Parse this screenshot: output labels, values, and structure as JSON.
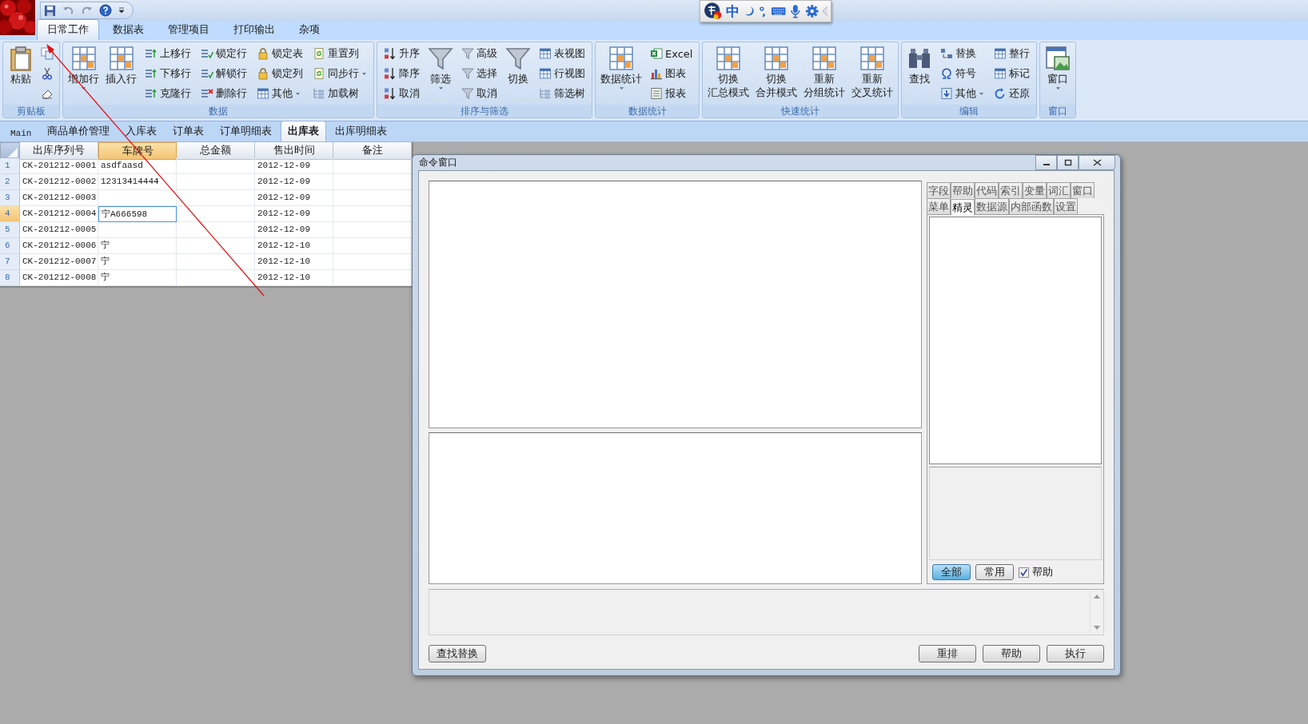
{
  "ribbon": {
    "tabs": [
      {
        "label": "日常工作",
        "selected": true
      },
      {
        "label": "数据表",
        "selected": false
      },
      {
        "label": "管理项目",
        "selected": false
      },
      {
        "label": "打印输出",
        "selected": false
      },
      {
        "label": "杂项",
        "selected": false
      }
    ],
    "groups": [
      {
        "label": "剪贴板",
        "kind": "clipboard",
        "columns": [
          {
            "kind": "large",
            "label": "粘贴",
            "dropdown": false
          }
        ]
      },
      {
        "label": "数据",
        "kind": "plain",
        "columns": [
          {
            "kind": "large",
            "label": "增加行",
            "dropdown": true
          },
          {
            "kind": "large",
            "label": "插入行",
            "dropdown": false
          },
          {
            "kind": "stack",
            "items": [
              {
                "label": "上移行",
                "dropdown": false
              },
              {
                "label": "下移行",
                "dropdown": false
              },
              {
                "label": "克隆行",
                "dropdown": false
              }
            ]
          },
          {
            "kind": "stack",
            "items": [
              {
                "label": "锁定行",
                "dropdown": false
              },
              {
                "label": "解锁行",
                "dropdown": false
              },
              {
                "label": "删除行",
                "dropdown": false
              }
            ]
          },
          {
            "kind": "stack",
            "items": [
              {
                "label": "锁定表",
                "dropdown": false
              },
              {
                "label": "锁定列",
                "dropdown": false
              },
              {
                "label": "其他",
                "dropdown": true
              }
            ]
          },
          {
            "kind": "stack",
            "items": [
              {
                "label": "重置列",
                "dropdown": false
              },
              {
                "label": "同步行",
                "dropdown": true
              },
              {
                "label": "加载树",
                "dropdown": false
              }
            ]
          }
        ]
      },
      {
        "label": "排序与筛选",
        "kind": "plain",
        "columns": [
          {
            "kind": "stack",
            "items": [
              {
                "label": "升序",
                "dropdown": false
              },
              {
                "label": "降序",
                "dropdown": false
              },
              {
                "label": "取消",
                "dropdown": false
              }
            ]
          },
          {
            "kind": "large",
            "label": "筛选",
            "dropdown": true
          },
          {
            "kind": "stack",
            "items": [
              {
                "label": "高级",
                "dropdown": false
              },
              {
                "label": "选择",
                "dropdown": false
              },
              {
                "label": "取消",
                "dropdown": false
              }
            ]
          },
          {
            "kind": "large",
            "label": "切换",
            "dropdown": false
          },
          {
            "kind": "stack",
            "items": [
              {
                "label": "表视图",
                "dropdown": false
              },
              {
                "label": "行视图",
                "dropdown": false
              },
              {
                "label": "筛选树",
                "dropdown": false
              }
            ]
          }
        ]
      },
      {
        "label": "数据统计",
        "kind": "plain",
        "columns": [
          {
            "kind": "large",
            "label": "数据统计",
            "dropdown": true
          },
          {
            "kind": "stack",
            "items": [
              {
                "label": "Excel",
                "dropdown": false
              },
              {
                "label": "图表",
                "dropdown": false
              },
              {
                "label": "报表",
                "dropdown": false
              }
            ]
          }
        ]
      },
      {
        "label": "快速统计",
        "kind": "plain",
        "columns": [
          {
            "kind": "large",
            "lines": [
              "切换",
              "汇总模式"
            ],
            "dropdown": false
          },
          {
            "kind": "large",
            "lines": [
              "切换",
              "合并模式"
            ],
            "dropdown": false
          },
          {
            "kind": "large",
            "lines": [
              "重新",
              "分组统计"
            ],
            "dropdown": false
          },
          {
            "kind": "large",
            "lines": [
              "重新",
              "交叉统计"
            ],
            "dropdown": false
          }
        ]
      },
      {
        "label": "编辑",
        "kind": "plain",
        "columns": [
          {
            "kind": "large",
            "label": "查找",
            "dropdown": false
          },
          {
            "kind": "stack",
            "items": [
              {
                "label": "替换",
                "dropdown": false
              },
              {
                "label": "符号",
                "dropdown": false
              },
              {
                "label": "其他",
                "dropdown": true
              }
            ]
          },
          {
            "kind": "stack",
            "items": [
              {
                "label": "整行",
                "dropdown": false
              },
              {
                "label": "标记",
                "dropdown": false
              },
              {
                "label": "还原",
                "dropdown": false
              }
            ]
          }
        ]
      },
      {
        "label": "窗口",
        "kind": "plain",
        "columns": [
          {
            "kind": "large",
            "label": "窗口",
            "dropdown": true
          }
        ]
      }
    ]
  },
  "ime_toolbar": {
    "mode": "中"
  },
  "doc_tabs": [
    {
      "label": "Main",
      "selected": false
    },
    {
      "label": "商品单价管理",
      "selected": false
    },
    {
      "label": "入库表",
      "selected": false
    },
    {
      "label": "订单表",
      "selected": false
    },
    {
      "label": "订单明细表",
      "selected": false
    },
    {
      "label": "出库表",
      "selected": true
    },
    {
      "label": "出库明细表",
      "selected": false
    }
  ],
  "table": {
    "columns": [
      {
        "label": "出库序列号",
        "selected": false
      },
      {
        "label": "车牌号",
        "selected": true
      },
      {
        "label": "总金额",
        "selected": false
      },
      {
        "label": "售出时间",
        "selected": false
      },
      {
        "label": "备注",
        "selected": false
      }
    ],
    "rows": [
      {
        "number": "1",
        "selected": false,
        "cells": [
          "CK-201212-0001",
          "asdfaasd",
          "",
          "2012-12-09",
          ""
        ]
      },
      {
        "number": "2",
        "selected": false,
        "cells": [
          "CK-201212-0002",
          "12313414444",
          "",
          "2012-12-09",
          ""
        ]
      },
      {
        "number": "3",
        "selected": false,
        "cells": [
          "CK-201212-0003",
          "",
          "",
          "2012-12-09",
          ""
        ]
      },
      {
        "number": "4",
        "selected": true,
        "cells": [
          "CK-201212-0004",
          "宁A666598",
          "",
          "2012-12-09",
          ""
        ]
      },
      {
        "number": "5",
        "selected": false,
        "cells": [
          "CK-201212-0005",
          "",
          "",
          "2012-12-09",
          ""
        ]
      },
      {
        "number": "6",
        "selected": false,
        "cells": [
          "CK-201212-0006",
          "宁",
          "",
          "2012-12-10",
          ""
        ]
      },
      {
        "number": "7",
        "selected": false,
        "cells": [
          "CK-201212-0007",
          "宁",
          "",
          "2012-12-10",
          ""
        ]
      },
      {
        "number": "8",
        "selected": false,
        "cells": [
          "CK-201212-0008",
          "宁",
          "",
          "2012-12-10",
          ""
        ]
      }
    ]
  },
  "command_window": {
    "title": "命令窗口",
    "tabs_row1": [
      {
        "label": "字段",
        "selected": false
      },
      {
        "label": "帮助",
        "selected": false
      },
      {
        "label": "代码",
        "selected": false
      },
      {
        "label": "索引",
        "selected": false
      },
      {
        "label": "变量",
        "selected": false
      },
      {
        "label": "词汇",
        "selected": false
      },
      {
        "label": "窗口",
        "selected": false
      }
    ],
    "tabs_row2": [
      {
        "label": "菜单",
        "selected": false
      },
      {
        "label": "精灵",
        "selected": true
      },
      {
        "label": "数据源",
        "selected": false
      },
      {
        "label": "内部函数",
        "selected": false
      },
      {
        "label": "设置",
        "selected": false
      }
    ],
    "filter_buttons": [
      {
        "label": "全部",
        "selected": true
      },
      {
        "label": "常用",
        "selected": false
      }
    ],
    "help_checkbox": {
      "label": "帮助",
      "checked": true
    },
    "find_button": "查找替换",
    "buttons": [
      "重排",
      "帮助",
      "执行"
    ]
  }
}
